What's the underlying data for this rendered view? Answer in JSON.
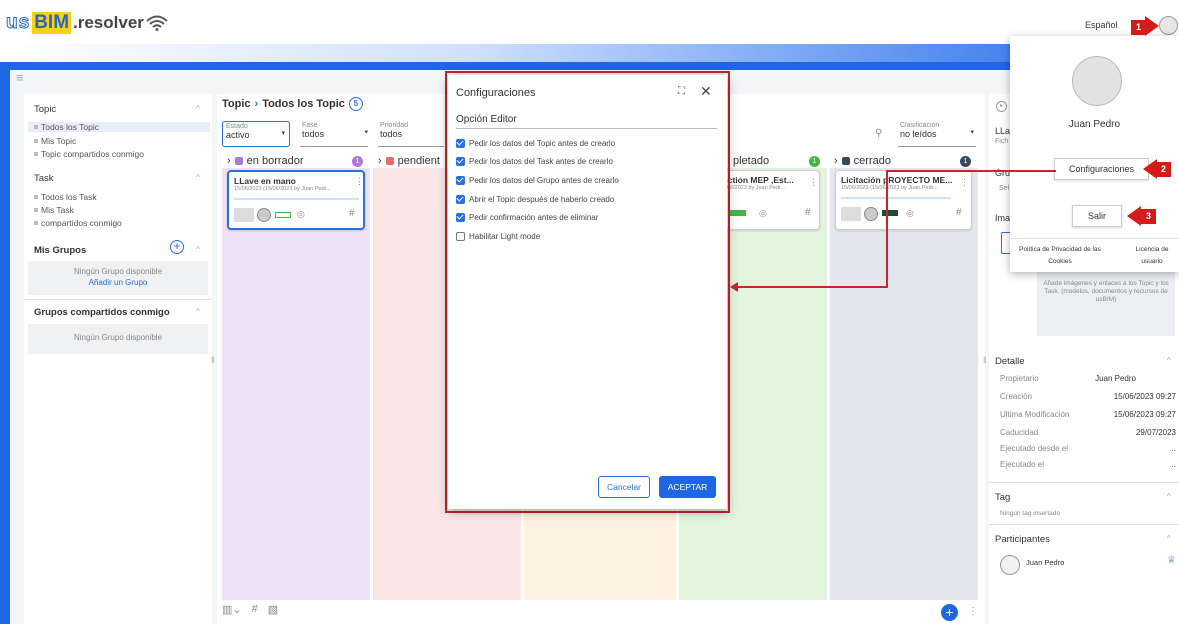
{
  "logo": {
    "us": "us",
    "bim": "BIM",
    "res": ".resolver"
  },
  "header": {
    "language": "Español"
  },
  "sidebar": {
    "topic_header": "Topic",
    "topic_items": [
      "Todos los Topic",
      "Mis Topic",
      "Topic compartidos conmigo"
    ],
    "task_header": "Task",
    "task_items": [
      "Todos los Task",
      "Mis Task",
      "compartidos conmigo"
    ],
    "groups_header": "Mis Grupos",
    "groups_empty": "Ningún Grupo disponible",
    "groups_add": "Añadir un Grupo",
    "shared_groups_header": "Grupos compartidos conmigo",
    "shared_groups_empty": "Ningún Grupo disponible"
  },
  "board": {
    "breadcrumb_root": "Topic",
    "breadcrumb_current": "Todos los Topic",
    "count": "5",
    "filters": [
      {
        "label": "Estado",
        "value": "activo"
      },
      {
        "label": "Fase",
        "value": "todos"
      },
      {
        "label": "Prioridad",
        "value": "todos"
      },
      {
        "label": "Clasificación",
        "value": "no leídos"
      }
    ],
    "columns": [
      {
        "name": "en borrador",
        "count": "1",
        "color": "#a97ad6"
      },
      {
        "name": "pendient",
        "count": "",
        "color": "#e96a6a"
      },
      {
        "name": "pletado",
        "count": "1",
        "color": "#46b548"
      },
      {
        "name": "cerrado",
        "count": "1",
        "color": "#34495e"
      }
    ],
    "cards": [
      {
        "title": "LLave en mano",
        "date": "15/06/2023 (15/06/2023 by Juan Pedr..."
      },
      {
        "title": "ection MEP ,Est...",
        "date": "06/2023 by Juan Pedr..."
      },
      {
        "title": "Licitación pROYECTO ME...",
        "date": "15/06/2023 (15/06/2023 by Juan Pedr..."
      }
    ]
  },
  "right_panel": {
    "title_partial": "LLa",
    "sub_partial": "Fich",
    "gr_partial": "Gru",
    "sel_partial": "Sel",
    "ima_partial": "Ima",
    "images_hint": "Añade imágenes y enlaces a los Topic y los Task. (modelos, documentos y recursos de usBIM)",
    "detail_header": "Detalle",
    "detail_rows": [
      {
        "label": "Propietario",
        "value": "Juan Pedro"
      },
      {
        "label": "Creación",
        "value": "15/06/2023 09:27"
      },
      {
        "label": "Ultima Modificación",
        "value": "15/06/2023 09:27"
      },
      {
        "label": "Caducidad",
        "value": "29/07/2023"
      },
      {
        "label": "Ejecutado desde el",
        "value": ".."
      },
      {
        "label": "Ejecutado el",
        "value": ".."
      }
    ],
    "tag_header": "Tag",
    "tag_empty": "Ningún tag insertado",
    "participants_header": "Participantes",
    "participant": "Juan Pedro"
  },
  "user_popup": {
    "name": "Juan Pedro",
    "config_button": "Configuraciones",
    "logout_button": "Salir",
    "privacy": "Política de Privacidad de las Cookies",
    "license": "Licencia de usuario"
  },
  "markers": [
    "1",
    "2",
    "3"
  ],
  "dialog": {
    "title": "Configuraciones",
    "section": "Opción Editor",
    "options": [
      {
        "label": "Pedir los datos del Topic antes de crearlo",
        "checked": true
      },
      {
        "label": "Pedir los datos del Task antes de crearlo",
        "checked": true
      },
      {
        "label": "Pedir los datos del Grupo antes de crearlo",
        "checked": true
      },
      {
        "label": "Abrir el Topic después de haberlo creado",
        "checked": true
      },
      {
        "label": "Pedir confirmación antes de eliminar",
        "checked": true
      },
      {
        "label": "Habilitar Light mode",
        "checked": false
      }
    ],
    "cancel": "Cancelar",
    "accept": "ACEPTAR"
  }
}
